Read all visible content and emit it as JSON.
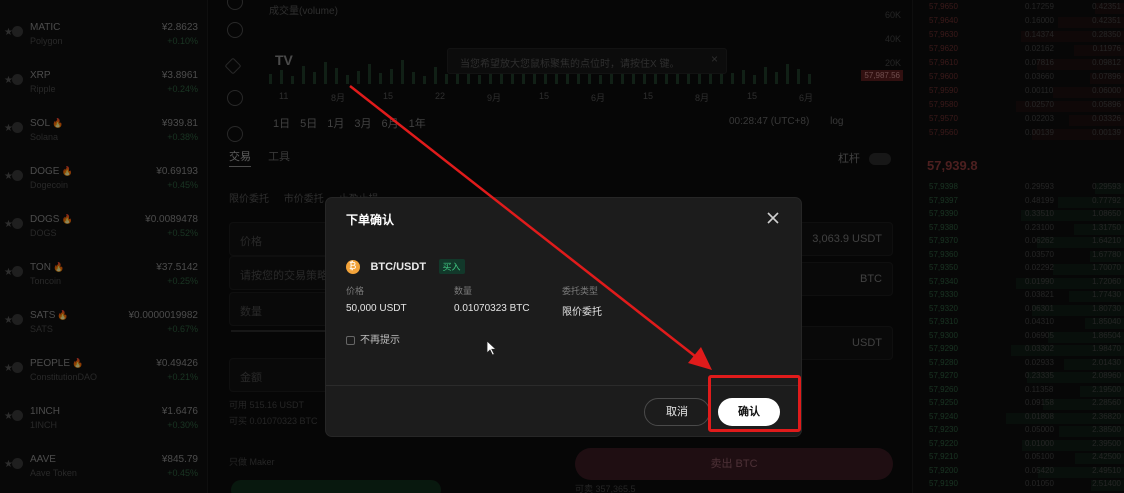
{
  "watchlist": [
    {
      "symbol": "MATIC",
      "hot": "",
      "name": "Polygon",
      "price": "¥2.8623",
      "change": "+0.10%"
    },
    {
      "symbol": "XRP",
      "hot": "",
      "name": "Ripple",
      "price": "¥3.8961",
      "change": "+0.24%"
    },
    {
      "symbol": "SOL",
      "hot": "🔥",
      "name": "Solana",
      "price": "¥939.81",
      "change": "+0.38%"
    },
    {
      "symbol": "DOGE",
      "hot": "🔥",
      "name": "Dogecoin",
      "price": "¥0.69193",
      "change": "+0.45%"
    },
    {
      "symbol": "DOGS",
      "hot": "🔥",
      "name": "DOGS",
      "price": "¥0.0089478",
      "change": "+0.52%"
    },
    {
      "symbol": "TON",
      "hot": "🔥",
      "name": "Toncoin",
      "price": "¥37.5142",
      "change": "+0.25%"
    },
    {
      "symbol": "SATS",
      "hot": "🔥",
      "name": "SATS",
      "price": "¥0.0000019982",
      "change": "+0.67%"
    },
    {
      "symbol": "PEOPLE",
      "hot": "🔥",
      "name": "ConstitutionDAO",
      "price": "¥0.49426",
      "change": "+0.21%"
    },
    {
      "symbol": "1INCH",
      "hot": "",
      "name": "1INCH",
      "price": "¥1.6476",
      "change": "+0.30%"
    },
    {
      "symbol": "AAVE",
      "hot": "",
      "name": "Aave Token",
      "price": "¥845.79",
      "change": "+0.45%"
    }
  ],
  "chart": {
    "volume_label": "成交量(volume)",
    "tooltip_hint": "当您希望放大您鼠标聚焦的点位时，请按住X 键。",
    "dates": [
      "11",
      "8月",
      "15",
      "22",
      "9月",
      "15",
      "6月",
      "15",
      "8月",
      "15",
      "6月"
    ],
    "ranges": [
      "1日",
      "5日",
      "1月",
      "3月",
      "6月",
      "1年"
    ],
    "clock": "00:28:47 (UTC+8)",
    "log_label": "log",
    "price_tag": "57,987.56",
    "axis": [
      "60K",
      "40K",
      "20K"
    ]
  },
  "trade_panel": {
    "tabs": [
      "交易",
      "工具"
    ],
    "leverage_label": "杠杆",
    "order_types": [
      "限价委托",
      "市价委托",
      "止盈止损"
    ],
    "price_placeholder": "价格",
    "buy_qty_placeholder": "请按您的交易策略输入一个...",
    "qty_placeholder": "数量",
    "total_placeholder": "金额",
    "available_usdt": "可用 515.16 USDT",
    "max_buy": "可买 0.01070323 BTC",
    "reduce_only": "只做 Maker",
    "balance": "3,063.9 USDT",
    "unit_btc": "BTC",
    "unit_usdt": "USDT",
    "sell_button": "卖出 BTC",
    "sell_hint": "可卖 357,365.5"
  },
  "orderbook": {
    "mid_price": "57,939.8",
    "asks": [
      {
        "p": "57,9650",
        "q": "0.17259",
        "t": "0.42351"
      },
      {
        "p": "57,9640",
        "q": "0.16000",
        "t": "0.42351"
      },
      {
        "p": "57,9630",
        "q": "0.14374",
        "t": "0.28350"
      },
      {
        "p": "57,9620",
        "q": "0.02162",
        "t": "0.11976"
      },
      {
        "p": "57,9610",
        "q": "0.07816",
        "t": "0.09812"
      },
      {
        "p": "57,9600",
        "q": "0.03660",
        "t": "0.07896"
      },
      {
        "p": "57,9590",
        "q": "0.00110",
        "t": "0.06000"
      },
      {
        "p": "57,9580",
        "q": "0.02570",
        "t": "0.05896"
      },
      {
        "p": "57,9570",
        "q": "0.02203",
        "t": "0.03326"
      },
      {
        "p": "57,9560",
        "q": "0.00139",
        "t": "0.00139"
      }
    ],
    "bids": [
      {
        "p": "57,9398",
        "q": "0.29593",
        "t": "0.29593"
      },
      {
        "p": "57,9397",
        "q": "0.48199",
        "t": "0.77792"
      },
      {
        "p": "57,9390",
        "q": "0.33510",
        "t": "1.08650"
      },
      {
        "p": "57,9380",
        "q": "0.23100",
        "t": "1.31750"
      },
      {
        "p": "57,9370",
        "q": "0.06262",
        "t": "1.64210"
      },
      {
        "p": "57,9360",
        "q": "0.03570",
        "t": "1.67780"
      },
      {
        "p": "57,9350",
        "q": "0.02292",
        "t": "1.70070"
      },
      {
        "p": "57,9340",
        "q": "0.01990",
        "t": "1.72060"
      },
      {
        "p": "57,9330",
        "q": "0.03821",
        "t": "1.77430"
      },
      {
        "p": "57,9320",
        "q": "0.06301",
        "t": "1.80730"
      },
      {
        "p": "57,9310",
        "q": "0.04310",
        "t": "1.85040"
      },
      {
        "p": "57,9300",
        "q": "0.06905",
        "t": "1.86504"
      },
      {
        "p": "57,9290",
        "q": "0.03302",
        "t": "1.98470"
      },
      {
        "p": "57,9280",
        "q": "0.02933",
        "t": "2.01430"
      },
      {
        "p": "57,9270",
        "q": "0.23335",
        "t": "2.08960"
      },
      {
        "p": "57,9260",
        "q": "0.11358",
        "t": "2.19500"
      },
      {
        "p": "57,9250",
        "q": "0.09158",
        "t": "2.28560"
      },
      {
        "p": "57,9240",
        "q": "0.01808",
        "t": "2.36820"
      },
      {
        "p": "57,9230",
        "q": "0.05000",
        "t": "2.38500"
      },
      {
        "p": "57,9220",
        "q": "0.01000",
        "t": "2.39500"
      },
      {
        "p": "57,9210",
        "q": "0.05100",
        "t": "2.42500"
      },
      {
        "p": "57,9200",
        "q": "0.05420",
        "t": "2.49510"
      },
      {
        "p": "57,9190",
        "q": "0.01050",
        "t": "2.51400"
      }
    ]
  },
  "modal": {
    "title": "下单确认",
    "pair": "BTC/USDT",
    "side": "买入",
    "price_label": "价格",
    "price_value": "50,000 USDT",
    "qty_label": "数量",
    "qty_value": "0.01070323 BTC",
    "type_label": "委托类型",
    "type_value": "限价委托",
    "no_remind": "不再提示",
    "cancel": "取消",
    "confirm": "确认"
  },
  "colors": {
    "highlight": "#e01b1b",
    "arrow": "#e01b1b",
    "buy_green": "#3fc480",
    "sell_red": "#8a3a3a"
  }
}
